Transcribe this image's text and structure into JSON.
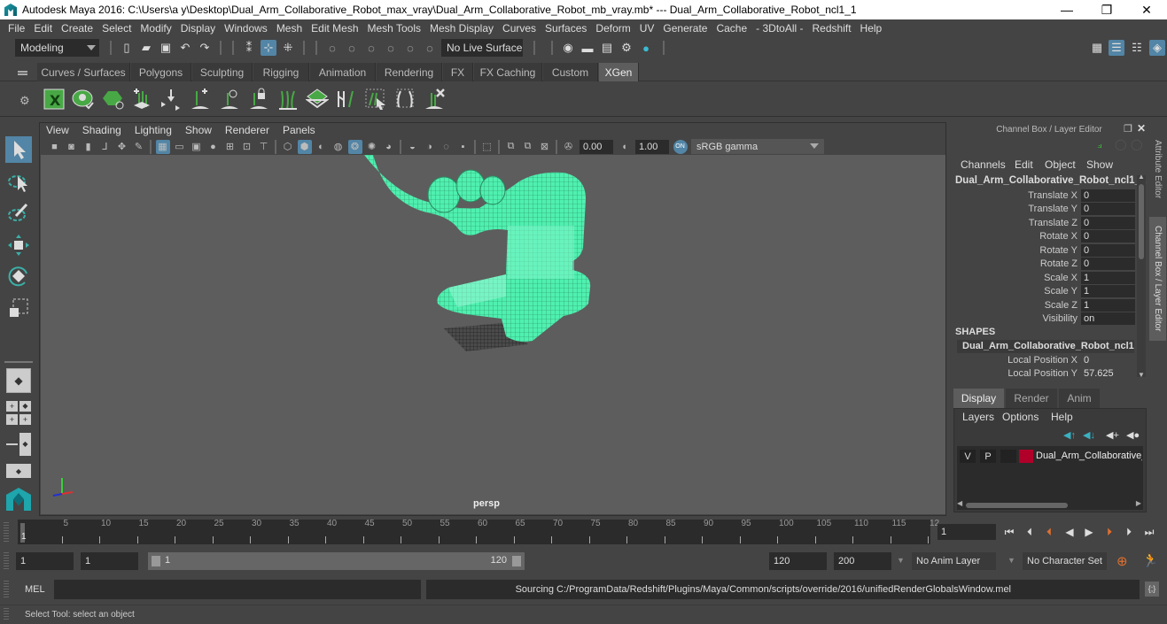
{
  "window": {
    "title": "Autodesk Maya 2016: C:\\Users\\a y\\Desktop\\Dual_Arm_Collaborative_Robot_max_vray\\Dual_Arm_Collaborative_Robot_mb_vray.mb*   ---   Dual_Arm_Collaborative_Robot_ncl1_1",
    "minimize": "—",
    "restore": "❐",
    "close": "✕"
  },
  "menubar": [
    "File",
    "Edit",
    "Create",
    "Select",
    "Modify",
    "Display",
    "Windows",
    "Mesh",
    "Edit Mesh",
    "Mesh Tools",
    "Mesh Display",
    "Curves",
    "Surfaces",
    "Deform",
    "UV",
    "Generate",
    "Cache",
    "- 3DtoAll -",
    "Redshift",
    "Help"
  ],
  "statusline": {
    "mode": "Modeling",
    "live_surface": "No Live Surface"
  },
  "shelf": {
    "tabs": [
      "Curves / Surfaces",
      "Polygons",
      "Sculpting",
      "Rigging",
      "Animation",
      "Rendering",
      "FX",
      "FX Caching",
      "Custom",
      "XGen"
    ],
    "active_tab": "XGen",
    "icons": [
      "xgen-editor-icon",
      "toggle-visibility-icon",
      "hide-primitives-icon",
      "add-guides-icon",
      "sculpt-guides-icon",
      "add-guide-icon",
      "select-guide-icon",
      "lock-guide-icon",
      "bend-guides-icon",
      "generate-mesh-icon",
      "rebuild-guides-icon",
      "select-cv-icon",
      "guide-length-icon",
      "delete-guide-icon"
    ]
  },
  "panel": {
    "menu": [
      "View",
      "Shading",
      "Lighting",
      "Show",
      "Renderer",
      "Panels"
    ],
    "exposure": "0.00",
    "gamma": "1.00",
    "color_space": "sRGB gamma",
    "camera_label": "persp"
  },
  "channelbox": {
    "header": "Channel Box / Layer Editor",
    "menu": [
      "Channels",
      "Edit",
      "Object",
      "Show"
    ],
    "object": "Dual_Arm_Collaborative_Robot_ncl1_1",
    "attributes": [
      {
        "label": "Translate X",
        "value": "0"
      },
      {
        "label": "Translate Y",
        "value": "0"
      },
      {
        "label": "Translate Z",
        "value": "0"
      },
      {
        "label": "Rotate X",
        "value": "0"
      },
      {
        "label": "Rotate Y",
        "value": "0"
      },
      {
        "label": "Rotate Z",
        "value": "0"
      },
      {
        "label": "Scale X",
        "value": "1"
      },
      {
        "label": "Scale Y",
        "value": "1"
      },
      {
        "label": "Scale Z",
        "value": "1"
      },
      {
        "label": "Visibility",
        "value": "on"
      }
    ],
    "shapes_header": "SHAPES",
    "shape_name": "Dual_Arm_Collaborative_Robot_ncl1...",
    "shape_attributes": [
      {
        "label": "Local Position X",
        "value": "0"
      },
      {
        "label": "Local Position Y",
        "value": "57.625"
      }
    ]
  },
  "side_tabs": [
    "Attribute Editor",
    "Channel Box / Layer Editor"
  ],
  "layers": {
    "tabs": [
      "Display",
      "Render",
      "Anim"
    ],
    "active_tab": "Display",
    "menu": [
      "Layers",
      "Options",
      "Help"
    ],
    "layer": {
      "v": "V",
      "p": "P",
      "name": "Dual_Arm_Collaborative_",
      "color": "#b0002a"
    }
  },
  "timeline": {
    "ticks": [
      "5",
      "10",
      "15",
      "20",
      "25",
      "30",
      "35",
      "40",
      "45",
      "50",
      "55",
      "60",
      "65",
      "70",
      "75",
      "80",
      "85",
      "90",
      "95",
      "100",
      "105",
      "110",
      "115",
      "12"
    ],
    "current_marker": "1",
    "current_frame": "1"
  },
  "range": {
    "start": "1",
    "playback_start": "1",
    "slider_start": "1",
    "slider_end": "120",
    "playback_end": "120",
    "end": "200",
    "anim_layer": "No Anim Layer",
    "character_set": "No Character Set"
  },
  "cmdline": {
    "label": "MEL",
    "output": "Sourcing C:/ProgramData/Redshift/Plugins/Maya/Common/scripts/override/2016/unifiedRenderGlobalsWindow.mel"
  },
  "helpline": "Select Tool: select an object",
  "colors": {
    "accent": "#5285a6",
    "wireframe": "#4ff0b0",
    "layer": "#b0002a"
  }
}
